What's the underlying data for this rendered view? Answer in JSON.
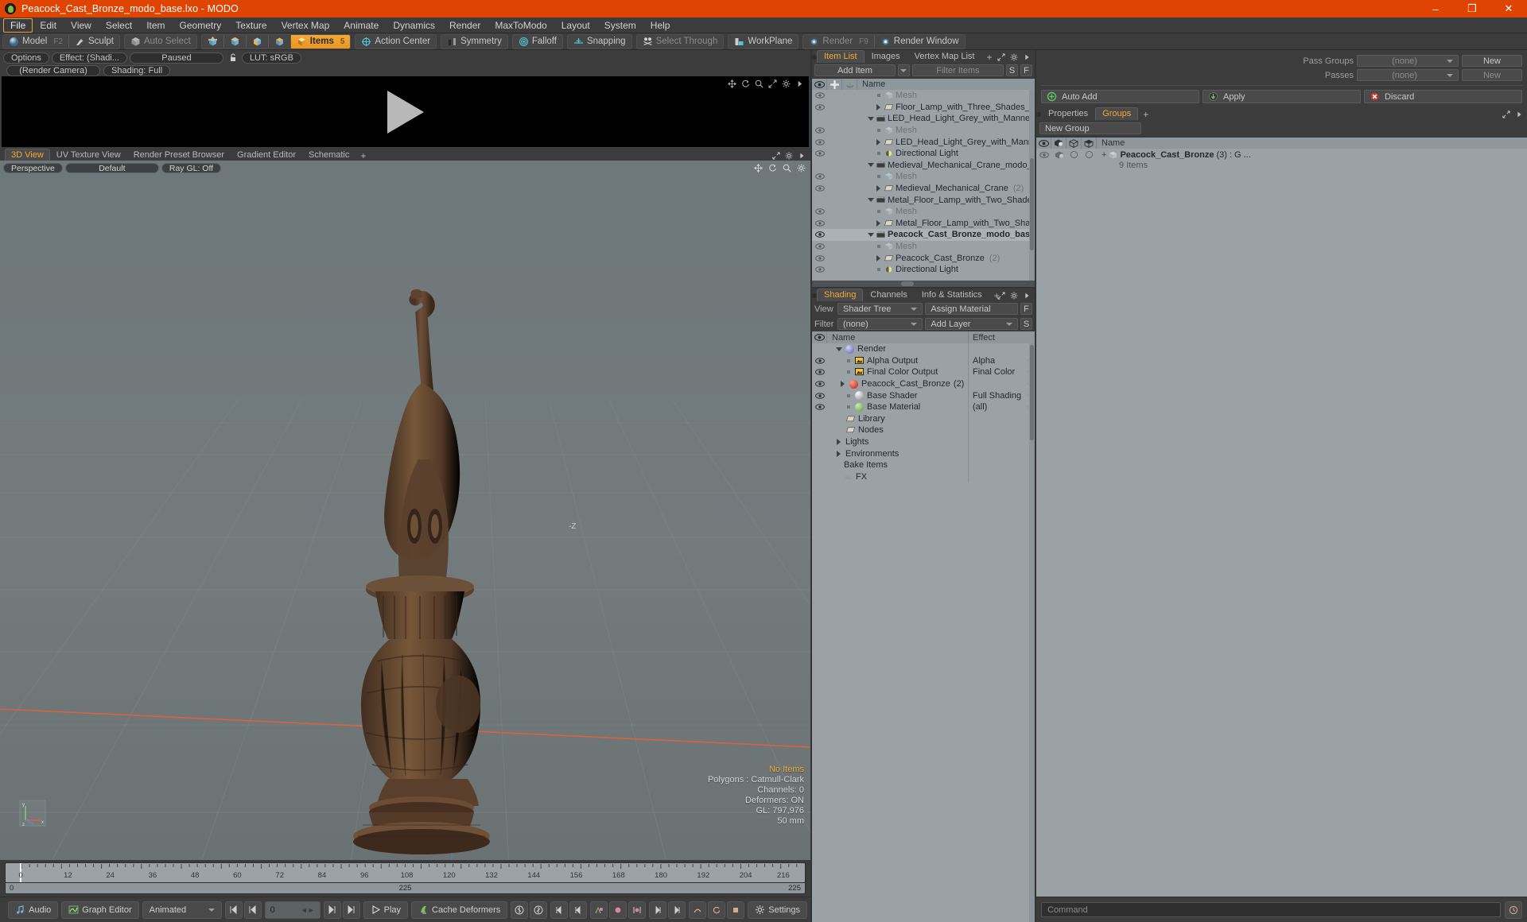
{
  "window": {
    "title": "Peacock_Cast_Bronze_modo_base.lxo - MODO",
    "minimize": "–",
    "maximize": "❐",
    "close": "✕"
  },
  "menubar": {
    "items": [
      {
        "label": "File",
        "active": true
      },
      {
        "label": "Edit",
        "active": false
      },
      {
        "label": "View",
        "active": false
      },
      {
        "label": "Select",
        "active": false
      },
      {
        "label": "Item",
        "active": false
      },
      {
        "label": "Geometry",
        "active": false
      },
      {
        "label": "Texture",
        "active": false
      },
      {
        "label": "Vertex Map",
        "active": false
      },
      {
        "label": "Animate",
        "active": false
      },
      {
        "label": "Dynamics",
        "active": false
      },
      {
        "label": "Render",
        "active": false
      },
      {
        "label": "MaxToModo",
        "active": false
      },
      {
        "label": "Layout",
        "active": false
      },
      {
        "label": "System",
        "active": false
      },
      {
        "label": "Help",
        "active": false
      }
    ]
  },
  "toolbar": {
    "model": "Model",
    "model_hotkey": "F2",
    "sculpt": "Sculpt",
    "auto_select": "Auto Select",
    "items": "Items",
    "items_hotkey": "5",
    "action_center": "Action Center",
    "symmetry": "Symmetry",
    "falloff": "Falloff",
    "snapping": "Snapping",
    "select_through": "Select Through",
    "workplane": "WorkPlane",
    "render": "Render",
    "render_hotkey": "F9",
    "render_window": "Render Window"
  },
  "render_window": {
    "options": "Options",
    "effect": "Effect: (Shadi...",
    "status": "Paused",
    "lut": "LUT: sRGB",
    "camera": "(Render Camera)",
    "shading": "Shading: Full"
  },
  "viewport": {
    "tabs": [
      {
        "label": "3D View",
        "active": true
      },
      {
        "label": "UV Texture View",
        "active": false
      },
      {
        "label": "Render Preset Browser",
        "active": false
      },
      {
        "label": "Gradient Editor",
        "active": false
      },
      {
        "label": "Schematic",
        "active": false
      }
    ],
    "plus": "+",
    "perspective": "Perspective",
    "style": "Default",
    "raygl": "Ray GL: Off",
    "axis_label_z": "-Z",
    "info": {
      "no_items": "No Items",
      "polygons": "Polygons : Catmull-Clark",
      "channels": "Channels: 0",
      "deformers": "Deformers: ON",
      "gl": "GL: 797,976",
      "scale": "50 mm"
    },
    "axis_x": "x",
    "axis_y": "y",
    "axis_z": "z"
  },
  "timeline": {
    "ticks": [
      "0",
      "12",
      "24",
      "36",
      "48",
      "60",
      "72",
      "84",
      "96",
      "108",
      "120",
      "132",
      "144",
      "156",
      "168",
      "180",
      "192",
      "204",
      "216"
    ],
    "range_start": "0",
    "range_mid": "225",
    "range_end": "225"
  },
  "bottombar": {
    "audio": "Audio",
    "graph_editor": "Graph Editor",
    "mode": "Animated",
    "frame": "0",
    "play": "Play",
    "cache_deformers": "Cache Deformers",
    "settings": "Settings",
    "command_placeholder": "Command"
  },
  "item_list": {
    "tabs": [
      {
        "label": "Item List",
        "active": true
      },
      {
        "label": "Images",
        "active": false
      },
      {
        "label": "Vertex Map List",
        "active": false
      }
    ],
    "plus": "+",
    "add_item": "Add Item",
    "filter_placeholder": "Filter Items",
    "btn_s": "S",
    "btn_f": "F",
    "col_name": "Name",
    "rows": [
      {
        "label": "Mesh",
        "indent": 2,
        "twirl": "dot",
        "icon": "mesh-icon",
        "muted": true,
        "eye": true,
        "bold": false,
        "count": ""
      },
      {
        "label": "Floor_Lamp_with_Three_Shades_Met ...",
        "indent": 2,
        "twirl": "right",
        "icon": "folder-icon",
        "muted": false,
        "eye": true,
        "bold": false,
        "count": ""
      },
      {
        "label": "LED_Head_Light_Grey_with_Mannequin ...",
        "indent": 1,
        "twirl": "down",
        "icon": "scene-icon",
        "muted": false,
        "eye": false,
        "bold": false,
        "count": ""
      },
      {
        "label": "Mesh",
        "indent": 2,
        "twirl": "dot",
        "icon": "mesh-icon",
        "muted": true,
        "eye": true,
        "bold": false,
        "count": ""
      },
      {
        "label": "LED_Head_Light_Grey_with_Mannequ...",
        "indent": 2,
        "twirl": "right",
        "icon": "folder-icon",
        "muted": false,
        "eye": true,
        "bold": false,
        "count": ""
      },
      {
        "label": "Directional Light",
        "indent": 2,
        "twirl": "dot",
        "icon": "light-icon",
        "muted": false,
        "eye": true,
        "bold": false,
        "count": ""
      },
      {
        "label": "Medieval_Mechanical_Crane_modo_bas ...",
        "indent": 1,
        "twirl": "down",
        "icon": "scene-icon",
        "muted": false,
        "eye": false,
        "bold": false,
        "count": ""
      },
      {
        "label": "Mesh",
        "indent": 2,
        "twirl": "dot",
        "icon": "mesh-icon",
        "muted": true,
        "eye": true,
        "bold": false,
        "count": ""
      },
      {
        "label": "Medieval_Mechanical_Crane",
        "indent": 2,
        "twirl": "right",
        "icon": "folder-icon",
        "muted": false,
        "eye": true,
        "bold": false,
        "count": "(2)"
      },
      {
        "label": "Metal_Floor_Lamp_with_Two_Shades_m ...",
        "indent": 1,
        "twirl": "down",
        "icon": "scene-icon",
        "muted": false,
        "eye": false,
        "bold": false,
        "count": ""
      },
      {
        "label": "Mesh",
        "indent": 2,
        "twirl": "dot",
        "icon": "mesh-icon",
        "muted": true,
        "eye": true,
        "bold": false,
        "count": ""
      },
      {
        "label": "Metal_Floor_Lamp_with_Two_Shades ...",
        "indent": 2,
        "twirl": "right",
        "icon": "folder-icon",
        "muted": false,
        "eye": true,
        "bold": false,
        "count": ""
      },
      {
        "label": "Peacock_Cast_Bronze_modo_bas ...",
        "indent": 1,
        "twirl": "down",
        "icon": "scene-icon",
        "muted": false,
        "eye": true,
        "bold": true,
        "count": ""
      },
      {
        "label": "Mesh",
        "indent": 2,
        "twirl": "dot",
        "icon": "mesh-icon",
        "muted": true,
        "eye": true,
        "bold": false,
        "count": ""
      },
      {
        "label": "Peacock_Cast_Bronze",
        "indent": 2,
        "twirl": "right",
        "icon": "folder-icon",
        "muted": false,
        "eye": true,
        "bold": false,
        "count": "(2)"
      },
      {
        "label": "Directional Light",
        "indent": 2,
        "twirl": "dot",
        "icon": "light-icon",
        "muted": false,
        "eye": true,
        "bold": false,
        "count": ""
      }
    ]
  },
  "shading": {
    "tabs": [
      {
        "label": "Shading",
        "active": true
      },
      {
        "label": "Channels",
        "active": false
      },
      {
        "label": "Info & Statistics",
        "active": false
      }
    ],
    "plus": "+",
    "view_label": "View",
    "view_value": "Shader Tree",
    "assign_material": "Assign Material",
    "btn_f": "F",
    "filter_label": "Filter",
    "filter_value": "(none)",
    "add_layer": "Add Layer",
    "btn_s": "S",
    "col_name": "Name",
    "col_effect": "Effect",
    "rows": [
      {
        "label": "Render",
        "effect": "",
        "indent": 1,
        "twirl": "down",
        "icon": "render-globe-icon",
        "eye": false,
        "dropdown": false,
        "count": ""
      },
      {
        "label": "Alpha Output",
        "effect": "Alpha",
        "indent": 2,
        "twirl": "dot",
        "icon": "output-icon",
        "eye": true,
        "dropdown": true,
        "count": ""
      },
      {
        "label": "Final Color Output",
        "effect": "Final Color",
        "indent": 2,
        "twirl": "dot",
        "icon": "output-icon",
        "eye": true,
        "dropdown": true,
        "count": ""
      },
      {
        "label": "Peacock_Cast_Bronze",
        "effect": "",
        "indent": 2,
        "twirl": "right",
        "icon": "material-red-icon",
        "eye": true,
        "dropdown": true,
        "count": "(2)"
      },
      {
        "label": "Base Shader",
        "effect": "Full Shading",
        "indent": 2,
        "twirl": "dot",
        "icon": "shader-icon",
        "eye": true,
        "dropdown": true,
        "count": ""
      },
      {
        "label": "Base Material",
        "effect": "(all)",
        "indent": 2,
        "twirl": "dot",
        "icon": "material-green-icon",
        "eye": true,
        "dropdown": true,
        "count": ""
      },
      {
        "label": "Library",
        "effect": "",
        "indent": 2,
        "twirl": "none",
        "icon": "folder-icon",
        "eye": false,
        "dropdown": false,
        "count": ""
      },
      {
        "label": "Nodes",
        "effect": "",
        "indent": 2,
        "twirl": "none",
        "icon": "folder-icon",
        "eye": false,
        "dropdown": false,
        "count": ""
      },
      {
        "label": "Lights",
        "effect": "",
        "indent": 1,
        "twirl": "right",
        "icon": "none",
        "eye": false,
        "dropdown": false,
        "count": ""
      },
      {
        "label": "Environments",
        "effect": "",
        "indent": 1,
        "twirl": "right",
        "icon": "none",
        "eye": false,
        "dropdown": false,
        "count": ""
      },
      {
        "label": "Bake Items",
        "effect": "",
        "indent": 1,
        "twirl": "none",
        "icon": "none",
        "eye": false,
        "dropdown": false,
        "count": ""
      },
      {
        "label": "FX",
        "effect": "",
        "indent": 1,
        "twirl": "none",
        "icon": "fx-icon",
        "eye": false,
        "dropdown": false,
        "count": ""
      }
    ]
  },
  "passes": {
    "pass_groups_label": "Pass Groups",
    "pass_groups_value": "(none)",
    "pass_groups_new": "New",
    "passes_label": "Passes",
    "passes_value": "(none)",
    "passes_new": "New",
    "auto_add": "Auto Add",
    "apply": "Apply",
    "discard": "Discard"
  },
  "groups": {
    "tabs": [
      {
        "label": "Properties",
        "active": false
      },
      {
        "label": "Groups",
        "active": true
      }
    ],
    "plus": "+",
    "new_group": "New Group",
    "col_name": "Name",
    "row": {
      "name": "Peacock_Cast_Bronze",
      "count": "(3)",
      "suffix": ": G ...",
      "subtitle": "9 Items",
      "expand": "+"
    }
  },
  "colors": {
    "titlebar": "#e04403",
    "accent": "#f3a93a",
    "panel": "#3c3c3c",
    "list": "#9aa2a6",
    "viewport": "#6e7678"
  }
}
